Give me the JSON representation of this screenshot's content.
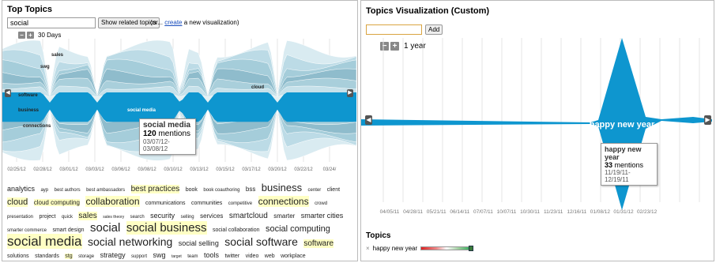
{
  "left": {
    "title": "Top Topics",
    "search_value": "social",
    "show_button": "Show related topics",
    "note_prefix": "(or...",
    "note_link": "create",
    "note_suffix": "a new visualization)",
    "zoom_label": "30 Days",
    "stream_labels": [
      "sales",
      "swg",
      "software",
      "business",
      "connections",
      "social media",
      "cloud"
    ],
    "x_ticks": [
      "02/25/12",
      "02/28/12",
      "03/01/12",
      "03/03/12",
      "03/06/12",
      "03/08/12",
      "03/10/12",
      "03/13/12",
      "03/15/12",
      "03/17/12",
      "03/20/12",
      "03/22/12",
      "03/24/"
    ],
    "tooltip": {
      "name": "social media",
      "count": "120",
      "unit": "mentions",
      "range": "03/07/12-03/08/12"
    },
    "cloud": [
      {
        "t": "analytics",
        "s": 9
      },
      {
        "t": "ayp",
        "s": 6
      },
      {
        "t": "best authors",
        "s": 6
      },
      {
        "t": "best ambassadors",
        "s": 6
      },
      {
        "t": "best practices",
        "s": 10,
        "hl": true
      },
      {
        "t": "book",
        "s": 7
      },
      {
        "t": "book coauthoring",
        "s": 6
      },
      {
        "t": "bss",
        "s": 8
      },
      {
        "t": "business",
        "s": 13
      },
      {
        "t": "center",
        "s": 6
      },
      {
        "t": "client",
        "s": 7
      },
      {
        "t": "cloud",
        "s": 11,
        "hl": true
      },
      {
        "t": "cloud computing",
        "s": 8,
        "hl": true
      },
      {
        "t": "collaboration",
        "s": 12,
        "hl": true
      },
      {
        "t": "communications",
        "s": 7
      },
      {
        "t": "communities",
        "s": 7
      },
      {
        "t": "competitive",
        "s": 6
      },
      {
        "t": "connections",
        "s": 12,
        "hl": true
      },
      {
        "t": "crowd",
        "s": 6
      },
      {
        "t": "presentation",
        "s": 6
      },
      {
        "t": "project",
        "s": 7
      },
      {
        "t": "quick",
        "s": 6
      },
      {
        "t": "sales",
        "s": 10,
        "hl": true
      },
      {
        "t": "sales theory",
        "s": 5
      },
      {
        "t": "search",
        "s": 6
      },
      {
        "t": "security",
        "s": 9
      },
      {
        "t": "selling",
        "s": 6
      },
      {
        "t": "services",
        "s": 8
      },
      {
        "t": "smartcloud",
        "s": 10
      },
      {
        "t": "smarter",
        "s": 8
      },
      {
        "t": "smarter cities",
        "s": 9
      },
      {
        "t": "smarter commerce",
        "s": 6
      },
      {
        "t": "smart design",
        "s": 7
      },
      {
        "t": "social",
        "s": 15
      },
      {
        "t": "social business",
        "s": 15,
        "hl": true
      },
      {
        "t": "social collaboration",
        "s": 7
      },
      {
        "t": "social computing",
        "s": 11
      },
      {
        "t": "social media",
        "s": 17,
        "hl": true
      },
      {
        "t": "social networking",
        "s": 14
      },
      {
        "t": "social selling",
        "s": 9
      },
      {
        "t": "social software",
        "s": 14
      },
      {
        "t": "software",
        "s": 10,
        "hl": true
      },
      {
        "t": "solutions",
        "s": 7
      },
      {
        "t": "standards",
        "s": 7
      },
      {
        "t": "stg",
        "s": 7,
        "hl": true
      },
      {
        "t": "storage",
        "s": 6
      },
      {
        "t": "strategy",
        "s": 9
      },
      {
        "t": "support",
        "s": 6
      },
      {
        "t": "swg",
        "s": 9
      },
      {
        "t": "target",
        "s": 5
      },
      {
        "t": "team",
        "s": 6
      },
      {
        "t": "tools",
        "s": 9
      },
      {
        "t": "twitter",
        "s": 7
      },
      {
        "t": "video",
        "s": 7
      },
      {
        "t": "web",
        "s": 7
      },
      {
        "t": "workplace",
        "s": 7
      }
    ]
  },
  "right": {
    "title": "Topics Visualization (Custom)",
    "input_value": "",
    "add_button": "Add",
    "zoom_label": "1 year",
    "stream_label": "happy new year",
    "x_ticks": [
      "04/05/11",
      "04/28/11",
      "05/21/11",
      "06/14/11",
      "07/07/11",
      "10/07/11",
      "10/30/11",
      "11/23/11",
      "12/16/11",
      "01/08/12",
      "01/31/12",
      "02/23/12"
    ],
    "tooltip": {
      "name": "happy new year",
      "count": "33",
      "unit": "mentions",
      "range": "11/19/11-12/19/11"
    },
    "topics_heading": "Topics",
    "topic_item": "happy new year"
  },
  "colors": {
    "stream_blue": "#0e96cf",
    "light_blue": "#bcdbe6",
    "mid_blue": "#8fbccc",
    "grid": "#ddd"
  }
}
